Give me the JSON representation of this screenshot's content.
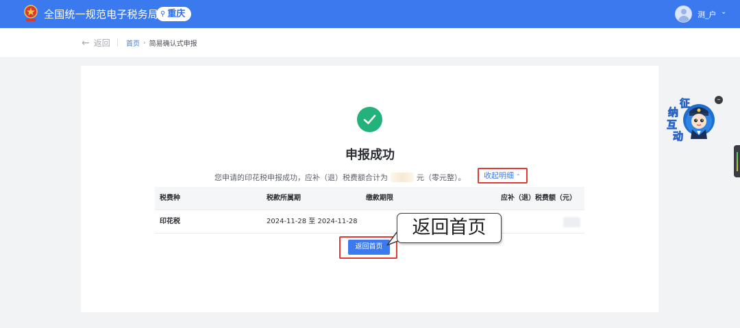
{
  "header": {
    "site_title": "全国统一规范电子税务局",
    "region": "重庆",
    "user_name": "测_户"
  },
  "subnav": {
    "back_label": "返回",
    "breadcrumb": {
      "home": "首页",
      "current": "简易确认式申报"
    }
  },
  "result": {
    "title": "申报成功",
    "message_prefix": "您申请的印花税申报成功，应补（退）税费额合计为",
    "message_suffix": "元（零元整）。",
    "collapse_label": "收起明细"
  },
  "table": {
    "headers": [
      "税费种",
      "税款所属期",
      "缴款期限",
      "应补（退）税费额（元）"
    ],
    "rows": [
      {
        "tax_type": "印花税",
        "period": "2024-11-28 至 2024-11-28",
        "deadline": ""
      }
    ]
  },
  "actions": {
    "return_home": "返回首页"
  },
  "annotation": {
    "callout_text": "返回首页"
  },
  "mascot": {
    "chars": [
      "征",
      "纳",
      "互",
      "动"
    ]
  },
  "colors": {
    "primary": "#3a79ee",
    "success": "#22b27a",
    "highlight": "#e23a32"
  }
}
